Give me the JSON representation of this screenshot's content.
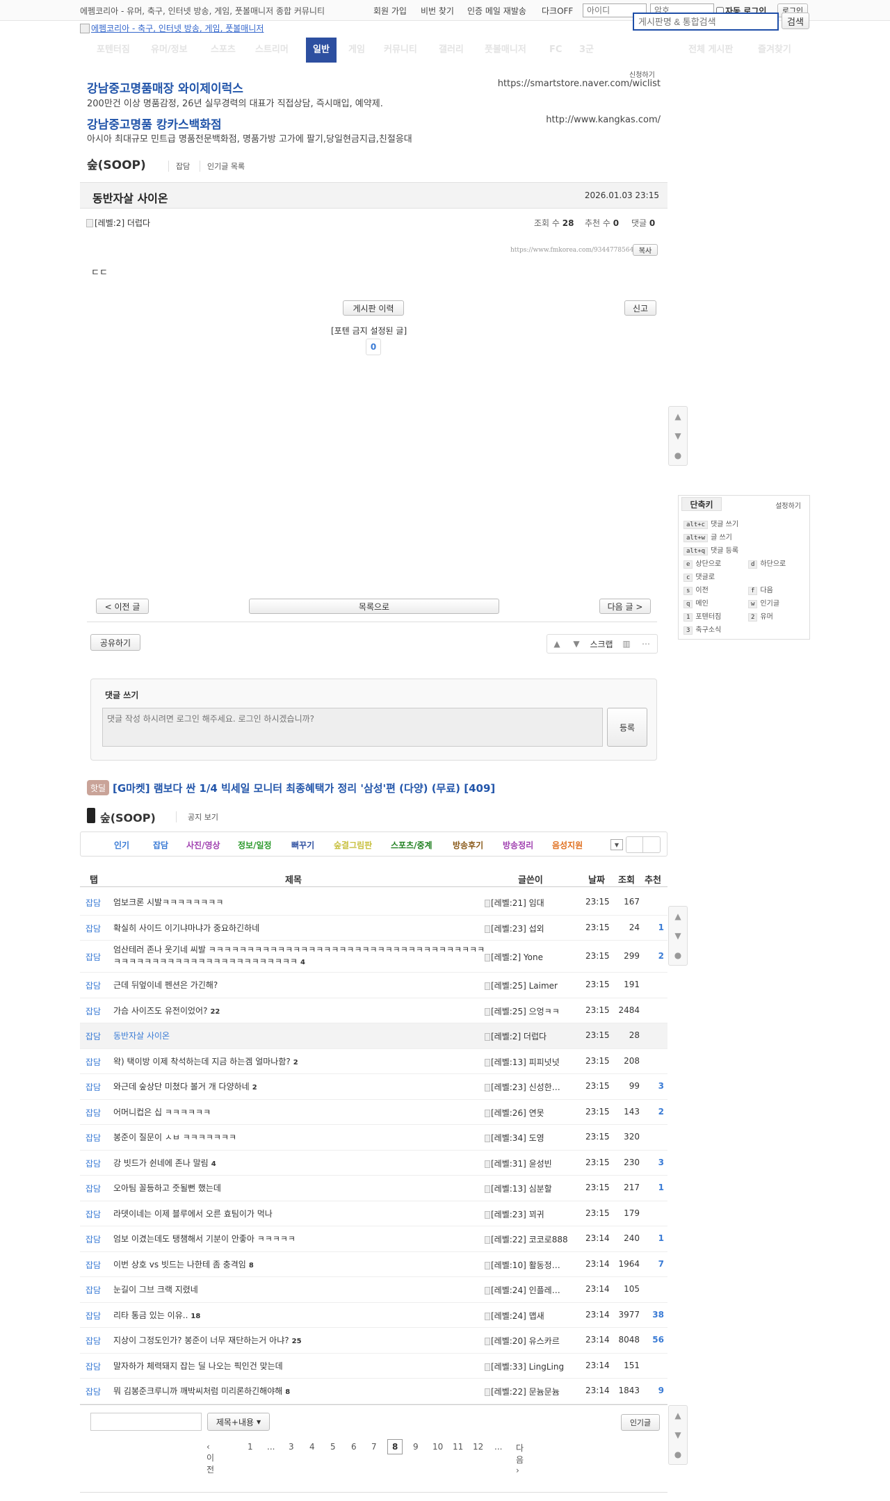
{
  "topbar": {
    "site_desc": "에펨코리아 - 유머, 축구, 인터넷 방송, 게임, 풋볼매니저 종합 커뮤니티",
    "signup": "회원 가입",
    "find_pw": "비번 찾기",
    "resend": "인증 메일 재발송",
    "dark": "다크OFF",
    "id_ph": "아이디",
    "pw_ph": "암호",
    "auto_login": "자동 로그인",
    "login": "로그인"
  },
  "header": {
    "logo_alt": "에펨코리아 - 축구, 인터넷 방송, 게임, 풋볼매니저",
    "search_ph": "게시판명 & 통합검색",
    "search_btn": "검색"
  },
  "nav": {
    "items": [
      "포텐터짐",
      "유머/정보",
      "스포츠",
      "스트리머",
      "일반",
      "게임",
      "커뮤니티",
      "갤러리",
      "풋볼매니저",
      "FC",
      "3군",
      "전체 게시판",
      "즐겨찾기"
    ]
  },
  "ads": {
    "apply": "신청하기",
    "items": [
      {
        "title": "강남중고명품매장 와이제이럭스",
        "desc": "200만건 이상 명품감정, 26년 실무경력의 대표가 직접상담, 즉시매입, 예약제.",
        "url": "https://smartstore.naver.com/wiclist"
      },
      {
        "title": "강남중고명품 캉카스백화점",
        "desc": "아시아 최대규모 민트급 명품전문백화점, 명품가방 고가에 팔기,당일현금지급,친절응대",
        "url": "http://www.kangkas.com/"
      }
    ]
  },
  "board": {
    "title": "숲(SOOP)",
    "tabs": [
      "잡담",
      "인기글 목록"
    ]
  },
  "post": {
    "title": "동반자살 사이온",
    "date": "2026.01.03 23:15",
    "author": "[레벨:2] 더럽다",
    "views_label": "조회 수",
    "views": "28",
    "recs_label": "추천 수",
    "recs": "0",
    "comments_label": "댓글",
    "comments": "0",
    "url": "https://www.fmkorea.com/9344778564",
    "copy": "복사",
    "body": "ㄷㄷ",
    "history": "게시판 이력",
    "report": "신고",
    "banned": "[포텐 금지 설정된 글]",
    "vote": "0"
  },
  "postnav": {
    "prev": "< 이전 글",
    "list": "목록으로",
    "next": "다음 글 >",
    "share": "공유하기",
    "scrap": "스크랩"
  },
  "shortcuts": {
    "title": "단축키",
    "settings": "설정하기",
    "items": [
      {
        "k": "alt+c",
        "l": "댓글 쓰기"
      },
      {
        "k": "alt+w",
        "l": "글 쓰기"
      },
      {
        "k": "alt+q",
        "l": "댓글 등록"
      },
      {
        "k": "e",
        "l": "상단으로"
      },
      {
        "k": "d",
        "l": "하단으로"
      },
      {
        "k": "c",
        "l": "댓글로"
      },
      {
        "k": "s",
        "l": "이전"
      },
      {
        "k": "f",
        "l": "다음"
      },
      {
        "k": "q",
        "l": "메인"
      },
      {
        "k": "w",
        "l": "인기글"
      },
      {
        "k": "1",
        "l": "포텐터짐"
      },
      {
        "k": "2",
        "l": "유머"
      },
      {
        "k": "3",
        "l": "축구소식"
      }
    ]
  },
  "comment": {
    "title": "댓글 쓰기",
    "placeholder": "댓글 작성 하시려면 로그인 해주세요. 로그인 하시겠습니까?",
    "submit": "등록"
  },
  "hotdeal": {
    "badge": "핫딜",
    "title": "[G마켓] 램보다 싼 1/4 빅세일 모니터 최종혜택가 정리 '삼성'편 (다양) (무료) [409]"
  },
  "list": {
    "board_title": "숲(SOOP)",
    "notice": "공지 보기",
    "cats": [
      {
        "l": "인기",
        "c": "#3a7bd5"
      },
      {
        "l": "잡담",
        "c": "#3a7bd5"
      },
      {
        "l": "사진/영상",
        "c": "#a040b0"
      },
      {
        "l": "정보/일정",
        "c": "#2c9a2c"
      },
      {
        "l": "뻐꾸기",
        "c": "#2d4fa0"
      },
      {
        "l": "숲결그림판",
        "c": "#c8c040"
      },
      {
        "l": "스포츠/중계",
        "c": "#208020"
      },
      {
        "l": "방송후기",
        "c": "#8a5a1a"
      },
      {
        "l": "방송정리",
        "c": "#a040b0"
      },
      {
        "l": "음성지원",
        "c": "#e07020"
      }
    ],
    "headers": {
      "tab": "탭",
      "title": "제목",
      "author": "글쓴이",
      "date": "날짜",
      "views": "조회",
      "recs": "추천"
    },
    "rows": [
      {
        "tab": "잡담",
        "title": "엄보크론 시발ㅋㅋㅋㅋㅋㅋㅋㅋ",
        "cc": "",
        "author": "[레벨:21] 임대",
        "time": "23:15",
        "views": "167",
        "recs": ""
      },
      {
        "tab": "잡담",
        "title": "확실히 사이드 이기냐마냐가 중요하긴하네",
        "cc": "",
        "author": "[레벨:23] 섭외",
        "time": "23:15",
        "views": "24",
        "recs": "1"
      },
      {
        "tab": "잡담",
        "title": "엄산테러 존나 웃기네 씨발 ㅋㅋㅋㅋㅋㅋㅋㅋㅋㅋㅋㅋㅋㅋㅋㅋㅋㅋㅋㅋㅋㅋㅋㅋㅋㅋㅋㅋㅋㅋㅋㅋㅋㅋㅋㅋㅋㅋㅋㅋㅋㅋㅋㅋㅋㅋㅋㅋㅋㅋㅋㅋㅋㅋㅋㅋㅋㅋㅋㅋ",
        "cc": "4",
        "author": "[레벨:2] Yone",
        "time": "23:15",
        "views": "299",
        "recs": "2"
      },
      {
        "tab": "잡담",
        "title": "근데 뒤엎이네 펜션은 가긴해?",
        "cc": "",
        "author": "[레벨:25] Laimer",
        "time": "23:15",
        "views": "191",
        "recs": ""
      },
      {
        "tab": "잡담",
        "title": "가슴 사이즈도 유전이었어?",
        "cc": "22",
        "author": "[레벨:25] 으엉ㅋㅋ",
        "time": "23:15",
        "views": "2484",
        "recs": ""
      },
      {
        "tab": "잡담",
        "title": "동반자살 사이온",
        "cc": "",
        "author": "[레벨:2] 더럽다",
        "time": "23:15",
        "views": "28",
        "recs": "",
        "cur": true
      },
      {
        "tab": "잡담",
        "title": "왁) 택이방 이제 착석하는데 지금 하는겜 얼마나함?",
        "cc": "2",
        "author": "[레벨:13] 피피넛넛",
        "time": "23:15",
        "views": "208",
        "recs": ""
      },
      {
        "tab": "잡담",
        "title": "와근데 숲상단 미쳤다 볼거 개 다양하네",
        "cc": "2",
        "author": "[레벨:23] 신성한…",
        "time": "23:15",
        "views": "99",
        "recs": "3"
      },
      {
        "tab": "잡담",
        "title": "어머니컵은 십 ㅋㅋㅋㅋㅋㅋ",
        "cc": "",
        "author": "[레벨:26] 연못",
        "time": "23:15",
        "views": "143",
        "recs": "2"
      },
      {
        "tab": "잡담",
        "title": "봉준이 질문이 ㅅㅂ ㅋㅋㅋㅋㅋㅋㅋ",
        "cc": "",
        "author": "[레벨:34] 도영",
        "time": "23:15",
        "views": "320",
        "recs": ""
      },
      {
        "tab": "잡담",
        "title": "강 빗드가 쉰네에 존나 말림",
        "cc": "4",
        "author": "[레벨:31] 윤성빈",
        "time": "23:15",
        "views": "230",
        "recs": "3"
      },
      {
        "tab": "잡담",
        "title": "오아팀 꼴등하고 줏될뻔 했는데",
        "cc": "",
        "author": "[레벨:13] 심분할",
        "time": "23:15",
        "views": "217",
        "recs": "1"
      },
      {
        "tab": "잡담",
        "title": "라뎃이네는 이제 블루에서 오른 효팀이가 먹나",
        "cc": "",
        "author": "[레벨:23] 꾀귀",
        "time": "23:15",
        "views": "179",
        "recs": ""
      },
      {
        "tab": "잡담",
        "title": "엄보 이겼는데도 탱챔해서 기분이 안좋아 ㅋㅋㅋㅋㅋ",
        "cc": "",
        "author": "[레벨:22] 코코로888",
        "time": "23:14",
        "views": "240",
        "recs": "1"
      },
      {
        "tab": "잡담",
        "title": "이번 상호 vs 빗드는 나한테 좀 충격임",
        "cc": "8",
        "author": "[레벨:10] 활동정…",
        "time": "23:14",
        "views": "1964",
        "recs": "7"
      },
      {
        "tab": "잡담",
        "title": "눈길이 그브 크랙 지렸네",
        "cc": "",
        "author": "[레벨:24] 인플레…",
        "time": "23:14",
        "views": "105",
        "recs": ""
      },
      {
        "tab": "잡담",
        "title": "리타 통금 있는 이유..",
        "cc": "18",
        "author": "[레벨:24] 맵새",
        "time": "23:14",
        "views": "3977",
        "recs": "38"
      },
      {
        "tab": "잡담",
        "title": "지상이 그정도인가? 봉준이 너무 재단하는거 아냐?",
        "cc": "25",
        "author": "[레벨:20] 유스카르",
        "time": "23:14",
        "views": "8048",
        "recs": "56"
      },
      {
        "tab": "잡담",
        "title": "말자하가 체력돼지 잡는 딜 나오는 픽인건 맞는데",
        "cc": "",
        "author": "[레벨:33] LingLing",
        "time": "23:14",
        "views": "151",
        "recs": ""
      },
      {
        "tab": "잡담",
        "title": "뭐 김봉준크루니까 깨박씨처럼 미리론하긴해야해",
        "cc": "8",
        "author": "[레벨:22] 문늄문늄",
        "time": "23:14",
        "views": "1843",
        "recs": "9"
      }
    ],
    "search_select": "제목+내용",
    "popular_btn": "인기글",
    "pagination": {
      "prev": "‹ 이전",
      "pages": [
        "1",
        "...",
        "3",
        "4",
        "5",
        "6",
        "7",
        "8",
        "9",
        "10",
        "11",
        "12",
        "..."
      ],
      "current": "8",
      "next": "다음 ›"
    }
  }
}
